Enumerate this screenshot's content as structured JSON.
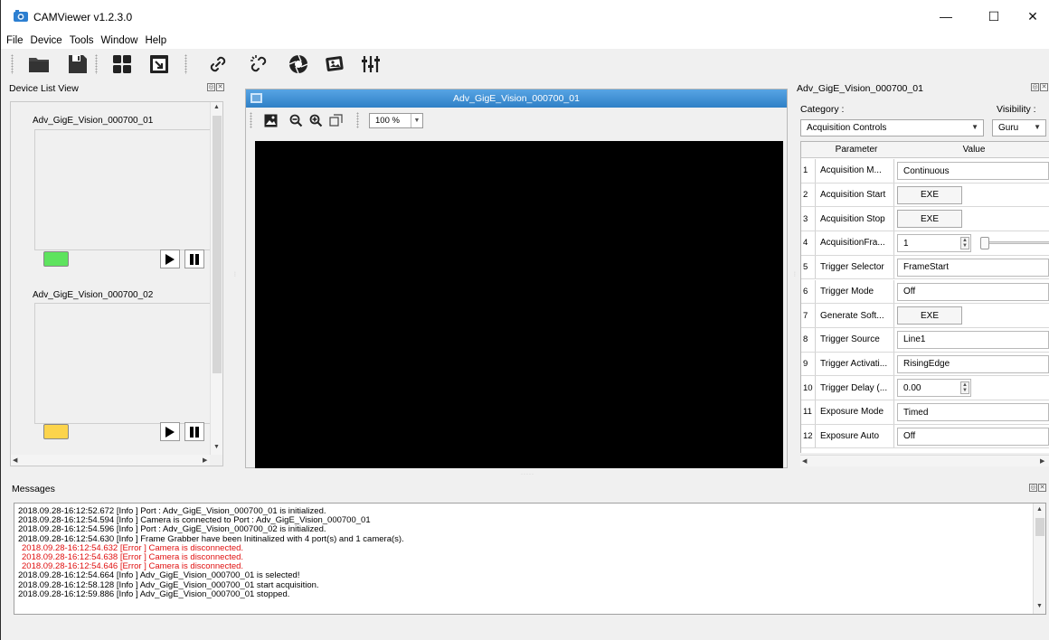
{
  "window": {
    "title": "CAMViewer v1.2.3.0",
    "controls": {
      "minimize": "—",
      "maximize": "☐",
      "close": "✕"
    }
  },
  "menu": [
    "File",
    "Device",
    "Tools",
    "Window",
    "Help"
  ],
  "toolbar": {
    "icons": [
      "folder-icon",
      "save-icon",
      "grid-layout-icon",
      "export-icon",
      "connect-link-icon",
      "disconnect-link-icon",
      "aperture-icon",
      "snapshot-icon",
      "sliders-icon"
    ]
  },
  "device_list": {
    "title": "Device List View",
    "devices": [
      {
        "name": "Adv_GigE_Vision_000700_01",
        "status_color": "#5ee35e"
      },
      {
        "name": "Adv_GigE_Vision_000700_02",
        "status_color": "#fcd44c"
      }
    ]
  },
  "video": {
    "title": "Adv_GigE_Vision_000700_01",
    "zoom": "100 %"
  },
  "params": {
    "title": "Adv_GigE_Vision_000700_01",
    "category_label": "Category :",
    "visibility_label": "Visibility :",
    "category_value": "Acquisition Controls",
    "visibility_value": "Guru",
    "columns": {
      "parameter": "Parameter",
      "value": "Value"
    },
    "rows": [
      {
        "num": "1",
        "name": "Acquisition M...",
        "kind": "select",
        "value": "Continuous"
      },
      {
        "num": "2",
        "name": "Acquisition Start",
        "kind": "exe",
        "value": "EXE"
      },
      {
        "num": "3",
        "name": "Acquisition Stop",
        "kind": "exe",
        "value": "EXE"
      },
      {
        "num": "4",
        "name": "AcquisitionFra...",
        "kind": "spin-slider",
        "value": "1"
      },
      {
        "num": "5",
        "name": "Trigger Selector",
        "kind": "select",
        "value": "FrameStart"
      },
      {
        "num": "6",
        "name": "Trigger Mode",
        "kind": "select",
        "value": "Off"
      },
      {
        "num": "7",
        "name": "Generate Soft...",
        "kind": "exe",
        "value": "EXE"
      },
      {
        "num": "8",
        "name": "Trigger Source",
        "kind": "select",
        "value": "Line1"
      },
      {
        "num": "9",
        "name": "Trigger Activati...",
        "kind": "select",
        "value": "RisingEdge"
      },
      {
        "num": "10",
        "name": "Trigger Delay (...",
        "kind": "spin",
        "value": "0.00"
      },
      {
        "num": "11",
        "name": "Exposure Mode",
        "kind": "select",
        "value": "Timed"
      },
      {
        "num": "12",
        "name": "Exposure Auto",
        "kind": "select",
        "value": "Off"
      }
    ]
  },
  "messages": {
    "title": "Messages",
    "lines": [
      {
        "text": "2018.09.28-16:12:52.672 [Info   ] Port : Adv_GigE_Vision_000700_01 is initialized.",
        "level": "info"
      },
      {
        "text": "2018.09.28-16:12:54.594 [Info   ] Camera is connected to Port : Adv_GigE_Vision_000700_01",
        "level": "info"
      },
      {
        "text": "2018.09.28-16:12:54.596 [Info   ] Port : Adv_GigE_Vision_000700_02 is initialized.",
        "level": "info"
      },
      {
        "text": "2018.09.28-16:12:54.630 [Info   ] Frame Grabber have been Initinalized with 4 port(s) and 1 camera(s).",
        "level": "info"
      },
      {
        "text": "2018.09.28-16:12:54.632 [Error ] Camera is disconnected.",
        "level": "error"
      },
      {
        "text": "2018.09.28-16:12:54.638 [Error ] Camera is disconnected.",
        "level": "error"
      },
      {
        "text": "2018.09.28-16:12:54.646 [Error ] Camera is disconnected.",
        "level": "error"
      },
      {
        "text": "2018.09.28-16:12:54.664 [Info   ] Adv_GigE_Vision_000700_01 is selected!",
        "level": "info"
      },
      {
        "text": "2018.09.28-16:12:58.128 [Info   ] Adv_GigE_Vision_000700_01 start acquisition.",
        "level": "info"
      },
      {
        "text": "2018.09.28-16:12:59.886 [Info   ] Adv_GigE_Vision_000700_01 stopped.",
        "level": "info"
      }
    ]
  }
}
